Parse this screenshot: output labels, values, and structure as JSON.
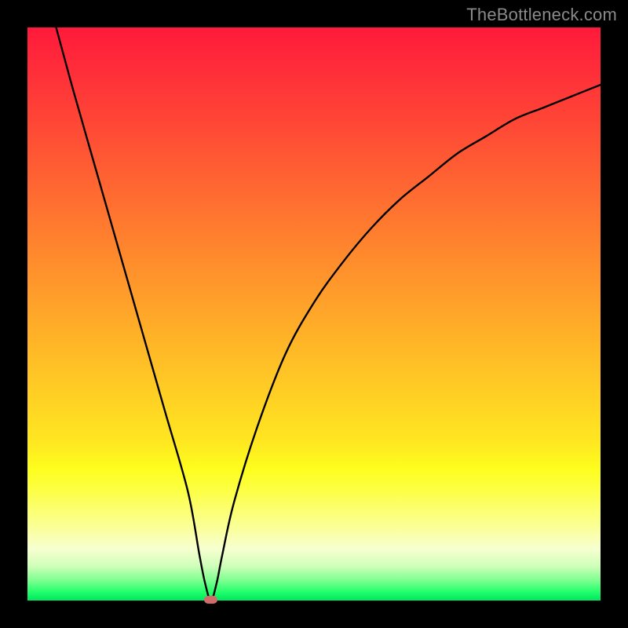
{
  "watermark": "TheBottleneck.com",
  "colors": {
    "page_bg": "#000000",
    "gradient_top": "#ff1a3b",
    "gradient_bottom": "#00e65f",
    "curve_stroke": "#000000",
    "marker_fill": "#d36a6a",
    "watermark_text": "#8a8a8a"
  },
  "chart_data": {
    "type": "line",
    "title": "",
    "xlabel": "",
    "ylabel": "",
    "xlim": [
      0,
      100
    ],
    "ylim": [
      0,
      100
    ],
    "series": [
      {
        "name": "bottleneck-curve",
        "x": [
          5,
          8,
          12,
          16,
          20,
          24,
          28,
          30,
          31,
          32,
          33,
          34,
          36,
          40,
          45,
          50,
          55,
          60,
          65,
          70,
          75,
          80,
          85,
          90,
          95,
          100
        ],
        "values": [
          100,
          89,
          75,
          61,
          47,
          33,
          19,
          8,
          3,
          0,
          3,
          8,
          17,
          30,
          43,
          52,
          59,
          65,
          70,
          74,
          78,
          81,
          84,
          86,
          88,
          90
        ]
      }
    ],
    "marker": {
      "name": "sweet-spot",
      "x": 32,
      "y": 0
    },
    "grid": false,
    "legend": false
  }
}
